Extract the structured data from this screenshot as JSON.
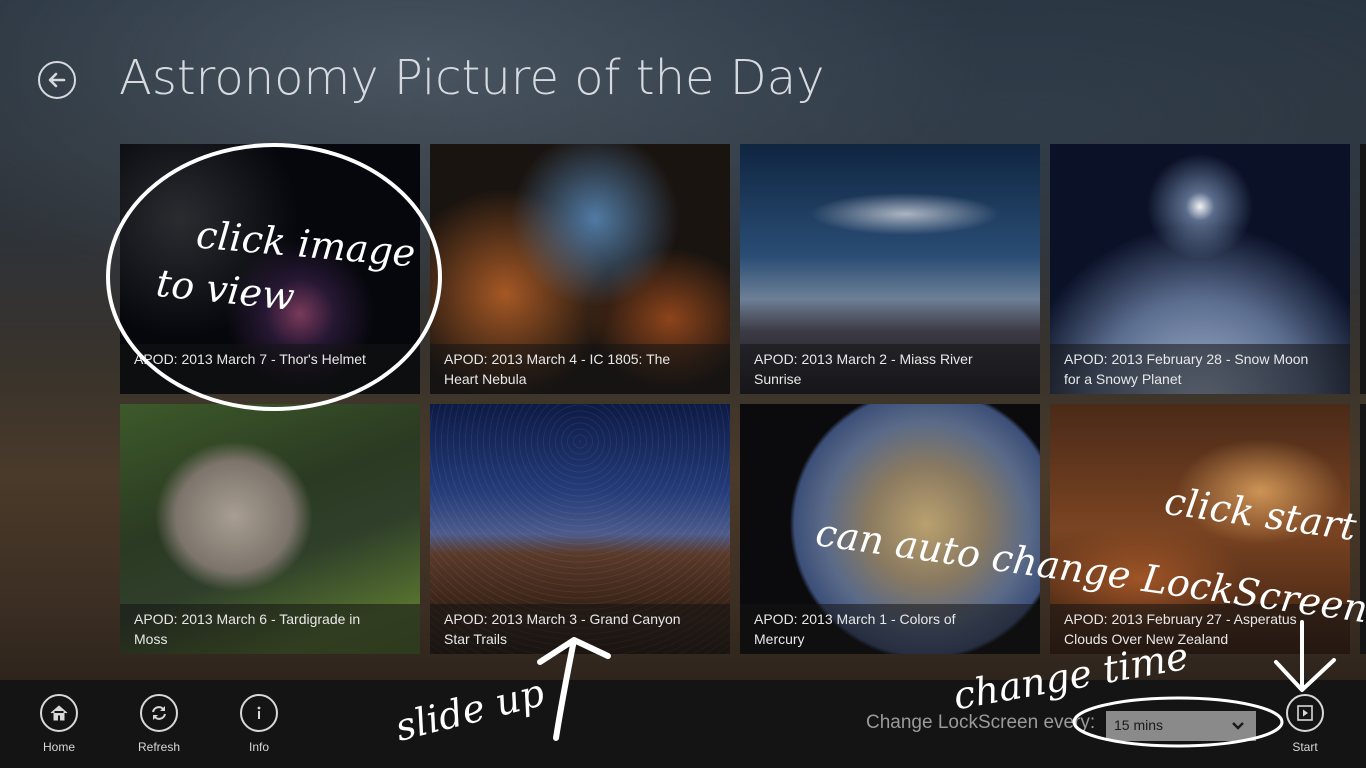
{
  "header": {
    "title": "Astronomy Picture of the Day"
  },
  "tiles": [
    {
      "caption": "APOD: 2013 March 7 - Thor's Helmet",
      "lines": [
        "APOD: 2013 March 7 - Thor's Helmet",
        ""
      ]
    },
    {
      "caption": "APOD: 2013 March 4 - IC 1805: The Heart Nebula",
      "lines": [
        "APOD: 2013 March 4 - IC 1805: The",
        "Heart Nebula"
      ]
    },
    {
      "caption": "APOD: 2013 March 2 - Miass River Sunrise",
      "lines": [
        "APOD: 2013 March 2 - Miass River",
        "Sunrise"
      ]
    },
    {
      "caption": "APOD: 2013 February 28 - Snow Moon for a Snowy Planet",
      "lines": [
        "APOD: 2013 February 28 - Snow Moon",
        "for a Snowy Planet"
      ]
    },
    {
      "caption": "APOD: 2013 March 6 - Tardigrade in Moss",
      "lines": [
        "APOD: 2013 March 6 - Tardigrade in",
        "Moss"
      ]
    },
    {
      "caption": "APOD: 2013 March 3 - Grand Canyon Star Trails",
      "lines": [
        "APOD: 2013 March 3 - Grand Canyon",
        "Star Trails"
      ]
    },
    {
      "caption": "APOD: 2013 March 1 - Colors of Mercury",
      "lines": [
        "APOD: 2013 March 1 - Colors of",
        "Mercury"
      ]
    },
    {
      "caption": "APOD: 2013 February 27 - Asperatus Clouds Over New Zealand",
      "lines": [
        "APOD: 2013 February 27 - Asperatus",
        "Clouds Over New Zealand"
      ]
    }
  ],
  "appbar": {
    "home_label": "Home",
    "refresh_label": "Refresh",
    "info_label": "Info",
    "lockscreen_label": "Change LockScreen every:",
    "interval_value": "15 mins",
    "start_label": "Start"
  },
  "annotations": {
    "click_image": "click image",
    "to_view": "to view",
    "can_auto": "can auto change LockScreen",
    "click_start": "click start",
    "change_time": "change time",
    "slide_up": "slide up"
  },
  "icons": {
    "back": "back-arrow-icon",
    "home": "home-icon",
    "refresh": "refresh-icon",
    "info": "info-icon",
    "start": "play-icon",
    "dropdown": "chevron-down-icon"
  },
  "colors": {
    "appbar_bg": "#141414",
    "title": "#d6dadf",
    "dropdown_bg": "#8a8a8a"
  }
}
